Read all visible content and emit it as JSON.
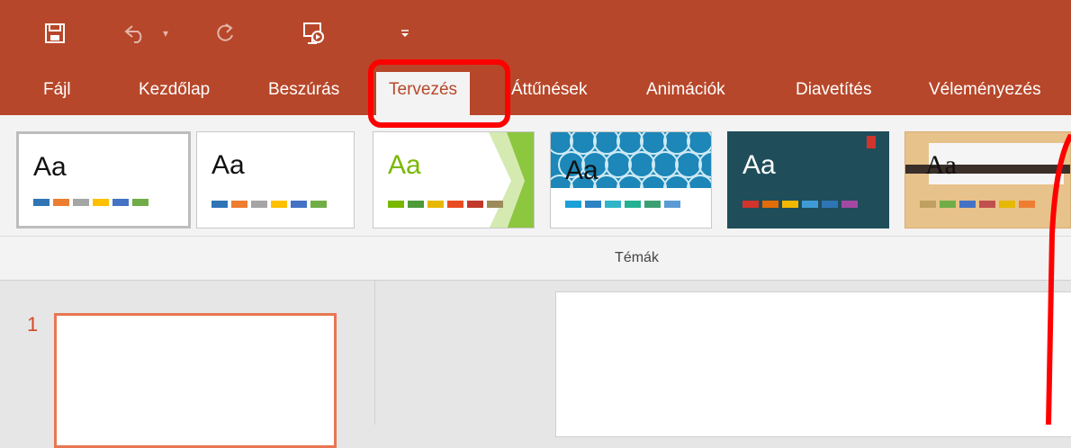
{
  "quick_access": {
    "icons": [
      "save-icon",
      "undo-icon",
      "undo-dropdown-icon",
      "redo-icon",
      "present-from-start-icon",
      "customize-qat-icon"
    ]
  },
  "tabs": [
    {
      "label": "Fájl"
    },
    {
      "label": "Kezdőlap"
    },
    {
      "label": "Beszúrás"
    },
    {
      "label": "Tervezés"
    },
    {
      "label": "Áttűnések"
    },
    {
      "label": "Animációk"
    },
    {
      "label": "Diavetítés"
    },
    {
      "label": "Véleményezés"
    }
  ],
  "ribbon": {
    "group_label": "Témák",
    "themes": [
      {
        "label": "Aa",
        "colors": [
          "#2f75b5",
          "#ed7d31",
          "#a5a5a5",
          "#ffc000",
          "#4472c4",
          "#70ad47"
        ]
      },
      {
        "label": "Aa",
        "colors": [
          "#2f75b5",
          "#ed7d31",
          "#a5a5a5",
          "#ffc000",
          "#4472c4",
          "#70ad47"
        ]
      },
      {
        "label": "Aa",
        "colors": [
          "#7ab800",
          "#4f9a3a",
          "#e6b800",
          "#e84c22",
          "#c0392b",
          "#9c8c5a"
        ]
      },
      {
        "label": "Aa",
        "colors": [
          "#1ca0d8",
          "#2d83c4",
          "#2fb5c7",
          "#24b191",
          "#3c9f72",
          "#5b9bd5"
        ]
      },
      {
        "label": "Aa",
        "colors": [
          "#d0342c",
          "#e36c09",
          "#f2b800",
          "#3f9bd5",
          "#2e75b6",
          "#a349a4"
        ]
      },
      {
        "label": "Aa",
        "colors": [
          "#c0a060",
          "#70ad47",
          "#4472c4",
          "#c0504d",
          "#e6b800",
          "#ed7d31"
        ]
      }
    ]
  },
  "slides": [
    {
      "number": "1"
    }
  ],
  "colors": {
    "accent": "#b7472a",
    "highlight": "#ff0000"
  }
}
